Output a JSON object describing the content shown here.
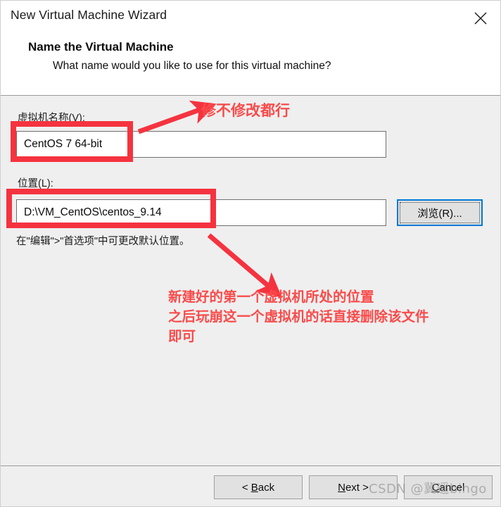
{
  "window": {
    "title": "New Virtual Machine Wizard",
    "close_icon": "close-icon"
  },
  "header": {
    "heading": "Name the Virtual Machine",
    "subtitle": "What name would you like to use for this virtual machine?"
  },
  "form": {
    "vm_name": {
      "label": "虚拟机名称(V):",
      "value": "CentOS 7 64-bit"
    },
    "location": {
      "label": "位置(L):",
      "value": "D:\\VM_CentOS\\centos_9.14",
      "hint": "在\"编辑\">\"首选项\"中可更改默认位置。",
      "browse_label": "浏览(R)..."
    }
  },
  "footer": {
    "back": {
      "prefix": "< ",
      "accel": "B",
      "suffix": "ack"
    },
    "next": {
      "prefix": "",
      "accel": "N",
      "suffix": "ext >"
    },
    "cancel": {
      "prefix": "",
      "accel": "C",
      "suffix": "ancel"
    }
  },
  "annotations": {
    "top_note": "修不修改都行",
    "bottom_note_line1": "新建好的第一个虚拟机所处的位置",
    "bottom_note_line2": "之后玩崩这一个虚拟机的话直接删除该文件",
    "bottom_note_line3": "即可",
    "color": "#f94b4b",
    "box_color": "#f5333f"
  },
  "watermark": {
    "text": "CSDN @冀遥bingo"
  }
}
